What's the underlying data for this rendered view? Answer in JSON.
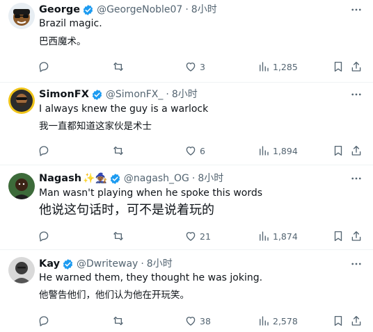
{
  "tweets": [
    {
      "name": "George",
      "verified": true,
      "emoji": "",
      "handle": "@GeorgeNoble07",
      "time": "8小时",
      "text_en": "Brazil magic.",
      "text_zh": "巴西魔术。",
      "replies": "",
      "reposts": "",
      "likes": "3",
      "views": "1,285"
    },
    {
      "name": "SimonFX",
      "verified": true,
      "emoji": "",
      "handle": "@SimonFX_",
      "time": "8小时",
      "text_en": "I always knew the guy is a warlock",
      "text_zh": "我一直都知道这家伙是术士",
      "replies": "",
      "reposts": "",
      "likes": "6",
      "views": "1,894"
    },
    {
      "name": "Nagash",
      "verified": true,
      "emoji": "✨🧙🏾",
      "handle": "@nagash_OG",
      "time": "8小时",
      "text_en": "Man wasn't playing when he spoke this words",
      "text_zh": "他说这句话时，可不是说着玩的",
      "replies": "",
      "reposts": "",
      "likes": "21",
      "views": "1,874"
    },
    {
      "name": "Kay",
      "verified": true,
      "emoji": "",
      "handle": "@Dwriteway",
      "time": "8小时",
      "text_en": "He warned them, they thought he was joking.",
      "text_zh": "他警告他们，他们认为他在开玩笑。",
      "replies": "",
      "reposts": "",
      "likes": "38",
      "views": "2,578"
    }
  ],
  "dot": "·",
  "colors": {
    "verified": "#1d9bf0",
    "muted": "#536471",
    "text": "#0f1419",
    "divider": "#eff3f4"
  },
  "icons": {
    "reply": "reply-icon",
    "repost": "repost-icon",
    "like": "like-icon",
    "views": "views-icon",
    "bookmark": "bookmark-icon",
    "share": "share-icon",
    "more": "more-icon"
  }
}
